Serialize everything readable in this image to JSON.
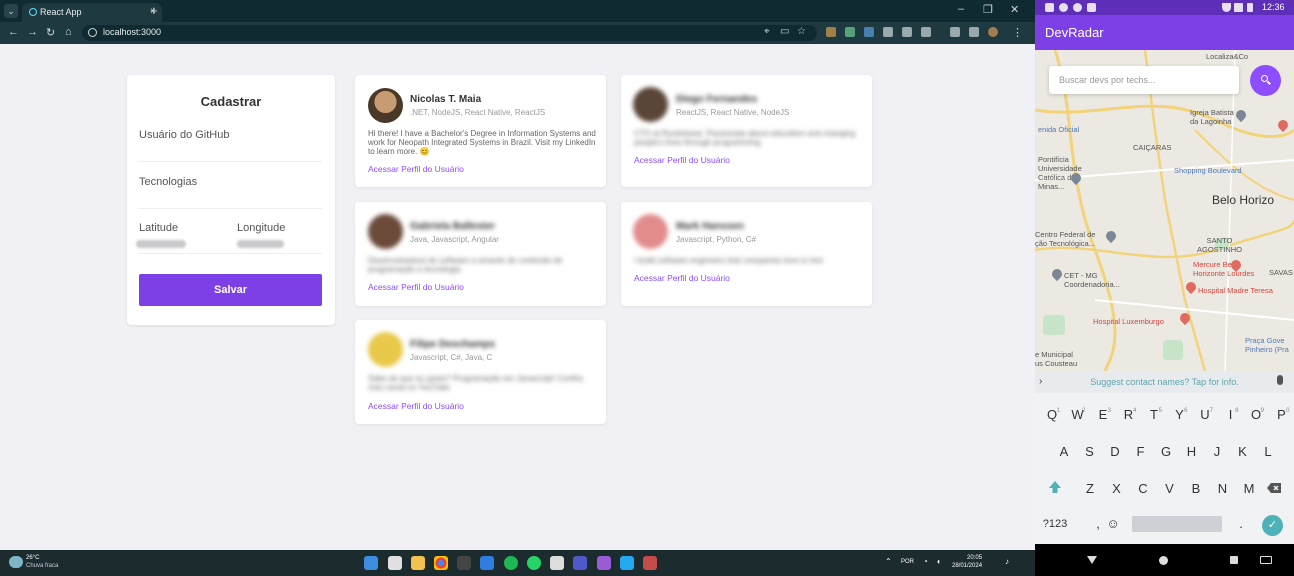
{
  "browser": {
    "tab_title": "React App",
    "url": "localhost:3000",
    "tab_close": "×",
    "new_tab": "+"
  },
  "form": {
    "title": "Cadastrar",
    "github_label": "Usuário do GitHub",
    "techs_label": "Tecnologias",
    "latitude_label": "Latitude",
    "longitude_label": "Longitude",
    "save_label": "Salvar"
  },
  "devs": [
    {
      "name": "Nicolas T. Maia",
      "techs": ".NET, NodeJS, React Native, ReactJS",
      "bio": "Hi there! I have a Bachelor's Degree in Information Systems and work for Neopath Integrated Systems in Brazil. Visit my LinkedIn to learn more. 😊",
      "link": "Acessar Perfil do Usuário",
      "avatar_color": "#8a6a48"
    },
    {
      "name": "Diego Fernandes",
      "techs": "ReactJS, React Native, NodeJS",
      "bio": "CTO at Rocketseat. Passionate about education and changing people's lives through programming",
      "link": "Acessar Perfil do Usuário",
      "avatar_color": "#5a4638"
    },
    {
      "name": "Gabriela Ballester",
      "techs": "Java, Javascript, Angular",
      "bio": "Desenvolvedora de software e amante de conteúdo de programação e tecnologia",
      "link": "Acessar Perfil do Usuário",
      "avatar_color": "#6b4a3a"
    },
    {
      "name": "Mark Hanssen",
      "techs": "Javascript, Python, C#",
      "bio": "I build software engineers that companies love to hire",
      "link": "Acessar Perfil do Usuário",
      "avatar_color": "#e38c8c"
    },
    {
      "name": "Filipe Deschamps",
      "techs": "Javascript, C#, Java, C",
      "bio": "Sabe do que eu gosto? Programação em Javascript! Confira meu canal no YouTube",
      "link": "Acessar Perfil do Usuário",
      "avatar_color": "#e8c94a"
    }
  ],
  "taskbar": {
    "temperature": "26°C",
    "weather": "Chuva fraca",
    "lang": "POR",
    "time": "20:05",
    "date": "28/01/2024"
  },
  "phone": {
    "status_time": "12:36",
    "app_title": "DevRadar",
    "search_placeholder": "Buscar devs por techs...",
    "suggest_text": "Suggest contact names? Tap for info.",
    "map_labels": {
      "localiza": "Localiza&Co",
      "igreja": "Igreja Batista\nda Lagoinha",
      "caicaras": "CAIÇARAS",
      "oficial": "enida Oficial",
      "pontificia": "Pontifícia\nUniversidade\nCatólica de\nMinas...",
      "shopping": "Shopping Boulevard",
      "belo": "Belo Horizo",
      "centro": "Centro Federal de\nção Tecnológica...",
      "santo": "SANTO\nAGOSTINHO",
      "mercure": "Mercure Belo\nHorizonte Lourdes",
      "savas": "SAVAS",
      "cet": "CET - MG\nCoordenadoria...",
      "madre": "Hospital Madre Teresa",
      "luxemburgo": "Hospital Luxemburgo",
      "praca": "Praça Gove\nPinheiro (Pra",
      "municipal": "e Municipal\nus Cousteau"
    },
    "keys_row1": [
      "Q",
      "W",
      "E",
      "R",
      "T",
      "Y",
      "U",
      "I",
      "O",
      "P"
    ],
    "keys_row1_sup": [
      "1",
      "2",
      "3",
      "4",
      "5",
      "6",
      "7",
      "8",
      "9",
      "0"
    ],
    "keys_row2": [
      "A",
      "S",
      "D",
      "F",
      "G",
      "H",
      "J",
      "K",
      "L"
    ],
    "keys_row3": [
      "Z",
      "X",
      "C",
      "V",
      "B",
      "N",
      "M"
    ],
    "key_numbers": "?123",
    "key_period": ".",
    "key_comma": ","
  },
  "colors": {
    "primary": "#7d40e7",
    "link": "#8e4dff",
    "background": "#f0f0f5"
  }
}
